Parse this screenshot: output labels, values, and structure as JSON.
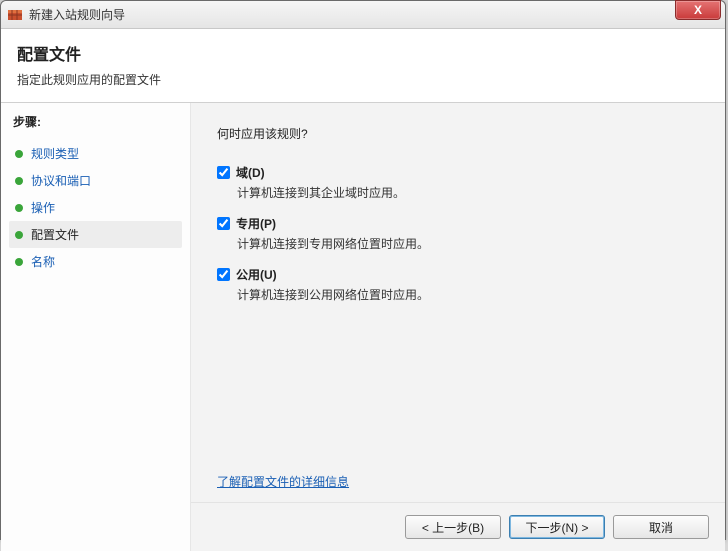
{
  "window": {
    "title": "新建入站规则向导",
    "close": "X"
  },
  "header": {
    "title": "配置文件",
    "subtitle": "指定此规则应用的配置文件"
  },
  "sidebar": {
    "steps_label": "步骤:",
    "items": [
      {
        "label": "规则类型",
        "state": "link"
      },
      {
        "label": "协议和端口",
        "state": "link"
      },
      {
        "label": "操作",
        "state": "link"
      },
      {
        "label": "配置文件",
        "state": "current"
      },
      {
        "label": "名称",
        "state": "link"
      }
    ]
  },
  "content": {
    "question": "何时应用该规则?",
    "options": [
      {
        "key": "domain",
        "checked": true,
        "label": "域(D)",
        "desc": "计算机连接到其企业域时应用。"
      },
      {
        "key": "private",
        "checked": true,
        "label": "专用(P)",
        "desc": "计算机连接到专用网络位置时应用。"
      },
      {
        "key": "public",
        "checked": true,
        "label": "公用(U)",
        "desc": "计算机连接到公用网络位置时应用。"
      }
    ],
    "learn_more": "了解配置文件的详细信息"
  },
  "footer": {
    "back": "< 上一步(B)",
    "next": "下一步(N) >",
    "cancel": "取消"
  }
}
